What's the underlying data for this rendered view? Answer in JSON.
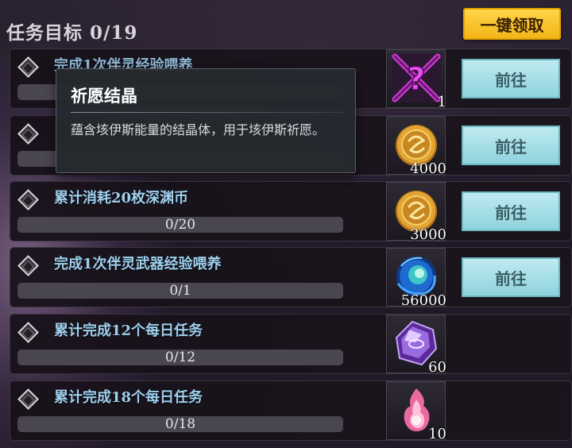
{
  "header": {
    "title": "任务目标 0/19",
    "claim_all_label": "一键领取"
  },
  "tasks": [
    {
      "name": "完成1次伴灵经验喂养",
      "progress": "",
      "reward_qty": "1",
      "reward_icon": "unknown-question-icon",
      "action": "前往"
    },
    {
      "name": "",
      "progress": "",
      "reward_qty": "4000",
      "reward_icon": "gold-abyss-coin-icon",
      "action": "前往"
    },
    {
      "name": "累计消耗20枚深渊币",
      "progress": "0/20",
      "reward_qty": "3000",
      "reward_icon": "gold-abyss-coin-icon",
      "action": "前往"
    },
    {
      "name": "完成1次伴灵武器经验喂养",
      "progress": "0/1",
      "reward_qty": "56000",
      "reward_icon": "blue-energy-orb-icon",
      "action": "前往"
    },
    {
      "name": "累计完成12个每日任务",
      "progress": "0/12",
      "reward_qty": "60",
      "reward_icon": "purple-wish-crystal-icon",
      "action": ""
    },
    {
      "name": "累计完成18个每日任务",
      "progress": "0/18",
      "reward_qty": "10",
      "reward_icon": "pink-flame-icon",
      "action": ""
    }
  ],
  "tooltip": {
    "title": "祈愿结晶",
    "description": "蕴含垓伊斯能量的结晶体，用于垓伊斯祈愿。"
  },
  "colors": {
    "accent_gold": "#f2b518",
    "go_button": "#a8dfe6",
    "task_name": "#9ed0ee"
  }
}
